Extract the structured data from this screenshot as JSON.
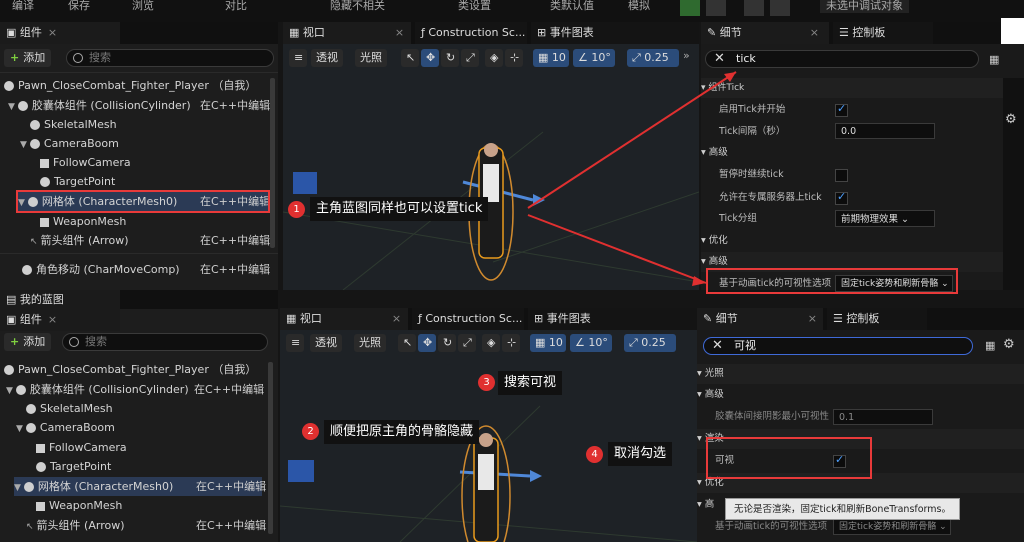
{
  "topbar": {
    "items": [
      "编译",
      "保存",
      "浏览",
      "对比",
      "隐藏不相关",
      "类设置",
      "类默认值",
      "模拟"
    ],
    "dropdown": "未选中调试对象"
  },
  "top": {
    "components_tab": "组件",
    "add": "添加",
    "search_placeholder": "搜索",
    "tree": [
      {
        "label": "Pawn_CloseCombat_Fighter_Player （自我）",
        "right": ""
      },
      {
        "label": "胶囊体组件 (CollisionCylinder)",
        "right": "在C++中编辑"
      },
      {
        "label": "SkeletalMesh",
        "right": ""
      },
      {
        "label": "CameraBoom",
        "right": ""
      },
      {
        "label": "FollowCamera",
        "right": ""
      },
      {
        "label": "TargetPoint",
        "right": ""
      },
      {
        "label": "网格体 (CharacterMesh0)",
        "right": "在C++中编辑"
      },
      {
        "label": "WeaponMesh",
        "right": ""
      },
      {
        "label": "箭头组件 (Arrow)",
        "right": "在C++中编辑"
      },
      {
        "label": "角色移动 (CharMoveComp)",
        "right": "在C++中编辑"
      }
    ],
    "tabs": [
      "视口",
      "Construction Sc...",
      "事件图表"
    ],
    "vp_tools": {
      "persp": "透视",
      "lit": "光照",
      "grid": "10",
      "rot": "10°",
      "scale": "0.25"
    },
    "details_tab": "细节",
    "console_tab": "控制板",
    "search_value": "tick",
    "details": [
      {
        "type": "hdr",
        "label": "组件Tick"
      },
      {
        "type": "check",
        "label": "启用Tick并开始",
        "on": true
      },
      {
        "type": "input",
        "label": "Tick间隔（秒）",
        "value": "0.0"
      },
      {
        "type": "hdr",
        "label": "高级"
      },
      {
        "type": "check",
        "label": "暂停时继续tick",
        "on": false
      },
      {
        "type": "check",
        "label": "允许在专属服务器上tick",
        "on": true
      },
      {
        "type": "dd",
        "label": "Tick分组",
        "value": "前期物理效果"
      },
      {
        "type": "hdr",
        "label": "优化"
      },
      {
        "type": "hdr",
        "label": "高级"
      },
      {
        "type": "dd",
        "label": "基于动画tick的可视性选项",
        "value": "固定tick姿势和刷新骨骼"
      }
    ],
    "callout": "主角蓝图同样也可以设置tick",
    "num": "1"
  },
  "bottom": {
    "blueprint_tab": "我的蓝图",
    "components_tab": "组件",
    "add": "添加",
    "search_placeholder": "搜索",
    "tree": [
      {
        "label": "Pawn_CloseCombat_Fighter_Player （自我）",
        "right": ""
      },
      {
        "label": "胶囊体组件 (CollisionCylinder)",
        "right": "在C++中编辑"
      },
      {
        "label": "SkeletalMesh",
        "right": ""
      },
      {
        "label": "CameraBoom",
        "right": ""
      },
      {
        "label": "FollowCamera",
        "right": ""
      },
      {
        "label": "TargetPoint",
        "right": ""
      },
      {
        "label": "网格体 (CharacterMesh0)",
        "right": "在C++中编辑"
      },
      {
        "label": "WeaponMesh",
        "right": ""
      },
      {
        "label": "箭头组件 (Arrow)",
        "right": "在C++中编辑"
      }
    ],
    "tabs": [
      "视口",
      "Construction Sc...",
      "事件图表"
    ],
    "vp_tools": {
      "persp": "透视",
      "lit": "光照",
      "grid": "10",
      "rot": "10°",
      "scale": "0.25"
    },
    "details_tab": "细节",
    "console_tab": "控制板",
    "search_value": "可视",
    "details": [
      {
        "type": "hdr",
        "label": "光照"
      },
      {
        "type": "hdr",
        "label": "高级"
      },
      {
        "type": "input",
        "label": "胶囊体间接阴影最小可视性",
        "value": "0.1"
      },
      {
        "type": "hdr",
        "label": "渲染"
      },
      {
        "type": "check",
        "label": "可视",
        "on": true
      },
      {
        "type": "hdr",
        "label": "优化"
      },
      {
        "type": "dd",
        "label": "基于动画tick的可视性选项",
        "value": "固定tick姿势和刷新骨骼"
      }
    ],
    "callouts": [
      {
        "num": "2",
        "text": "顺便把原主角的骨骼隐藏"
      },
      {
        "num": "3",
        "text": "搜索可视"
      },
      {
        "num": "4",
        "text": "取消勾选"
      }
    ],
    "tooltip": "无论是否渲染，固定tick和刷新BoneTransforms。",
    "partial_hdr": "高"
  }
}
